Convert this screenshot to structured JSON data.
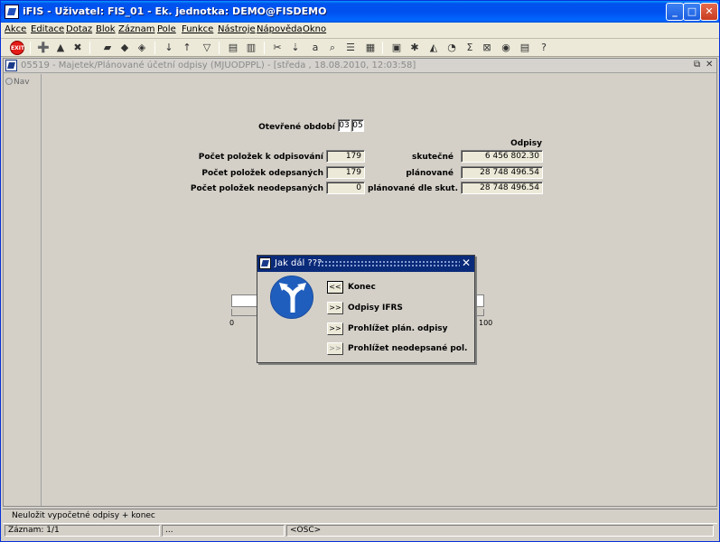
{
  "app": {
    "title": "iFIS - Uživatel: FIS_01 - Ek. jednotka: DEMO@FISDEMO",
    "window_controls": [
      "_",
      "□",
      "✕"
    ]
  },
  "menu": [
    "Akce",
    "Editace",
    "Dotaz",
    "Blok",
    "Záznam",
    "Pole",
    "Funkce",
    "Nástroje",
    "Nápověda",
    "Okno"
  ],
  "toolbar": {
    "exit_label": "EXIT"
  },
  "mdi": {
    "title": "05519 - Majetek/Plánované účetní odpisy (MJUODPPL) - [středa , 18.08.2010, 12:03:58]",
    "nav_label": "Nav",
    "controls": [
      "⧉",
      "✕"
    ]
  },
  "form": {
    "period_label": "Otevřené období",
    "period_month": "03",
    "period_year": "05",
    "odpisy_header": "Odpisy",
    "rows": [
      {
        "label": "Počet položek k odpisování",
        "count": "179",
        "type_label": "skutečné",
        "amount": "6 456 802.30"
      },
      {
        "label": "Počet položek odepsaných",
        "count": "179",
        "type_label": "plánované",
        "amount": "28 748 496.54"
      },
      {
        "label": "Počet položek neodepsaných",
        "count": "0",
        "type_label": "plánované dle skut.",
        "amount": "28 748 496.54"
      }
    ],
    "progress": {
      "min": "0",
      "max": "100",
      "value": 0
    }
  },
  "dialog": {
    "title": "Jak dál ???",
    "close_label": "✕",
    "options": [
      {
        "button": "<<",
        "label": "Konec"
      },
      {
        "button": ">>",
        "label": "Odpisy IFRS"
      },
      {
        "button": ">>",
        "label": "Prohlížet plán. odpisy"
      },
      {
        "button": ">>",
        "label": "Prohlížet neodepsané pol."
      }
    ]
  },
  "status": {
    "message": "Neuložit vypočetné odpisy + konec",
    "record": "Záznam: 1/1",
    "seg2": "...",
    "seg3": "<OSC>"
  }
}
